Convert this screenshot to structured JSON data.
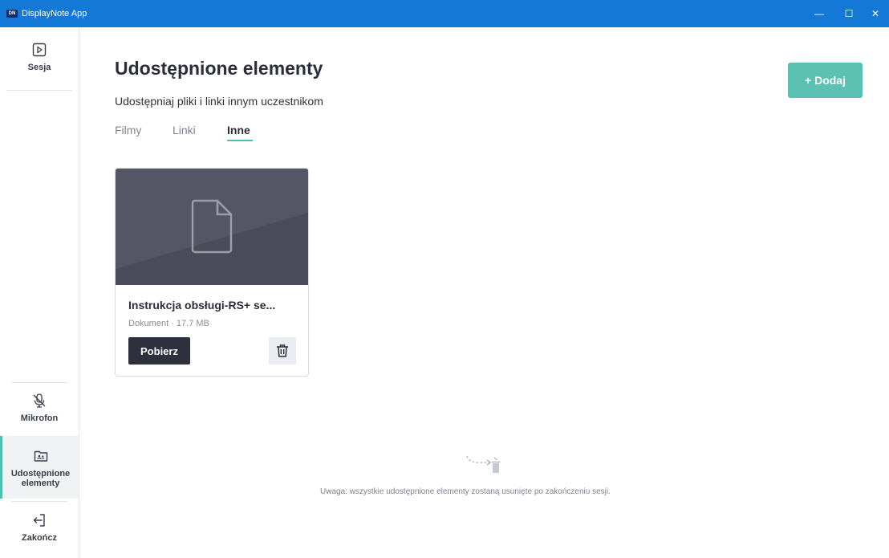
{
  "window": {
    "logo_text": "DN",
    "title": "DisplayNote App",
    "minimize_glyph": "—",
    "maximize_glyph": "☐",
    "close_glyph": "✕"
  },
  "sidebar": {
    "items": [
      {
        "label": "Sesja",
        "icon": "play-icon"
      },
      {
        "label": "Mikrofon",
        "icon": "microphone-off-icon"
      },
      {
        "label": "Udostępnione elementy",
        "icon": "shared-folder-icon",
        "active": true
      },
      {
        "label": "Zakończ",
        "icon": "exit-icon"
      }
    ]
  },
  "main": {
    "title": "Udostępnione elementy",
    "subtitle": "Udostępniaj pliki i linki innym uczestnikom",
    "add_button_label": "+ Dodaj",
    "tabs": [
      {
        "label": "Filmy"
      },
      {
        "label": "Linki"
      },
      {
        "label": "Inne",
        "active": true
      }
    ],
    "items": [
      {
        "name": "Instrukcja obsługi-RS+ se...",
        "meta": "Dokument · 17.7 MB",
        "download_label": "Pobierz",
        "icon": "document-icon"
      }
    ],
    "note": "Uwaga: wszystkie udostępnione elementy zostaną usunięte po zakończeniu sesji."
  },
  "colors": {
    "titlebar": "#1479d6",
    "accent": "#5cc0b3",
    "dark_button": "#2e303d",
    "thumbnail": "#4a4c5a"
  }
}
